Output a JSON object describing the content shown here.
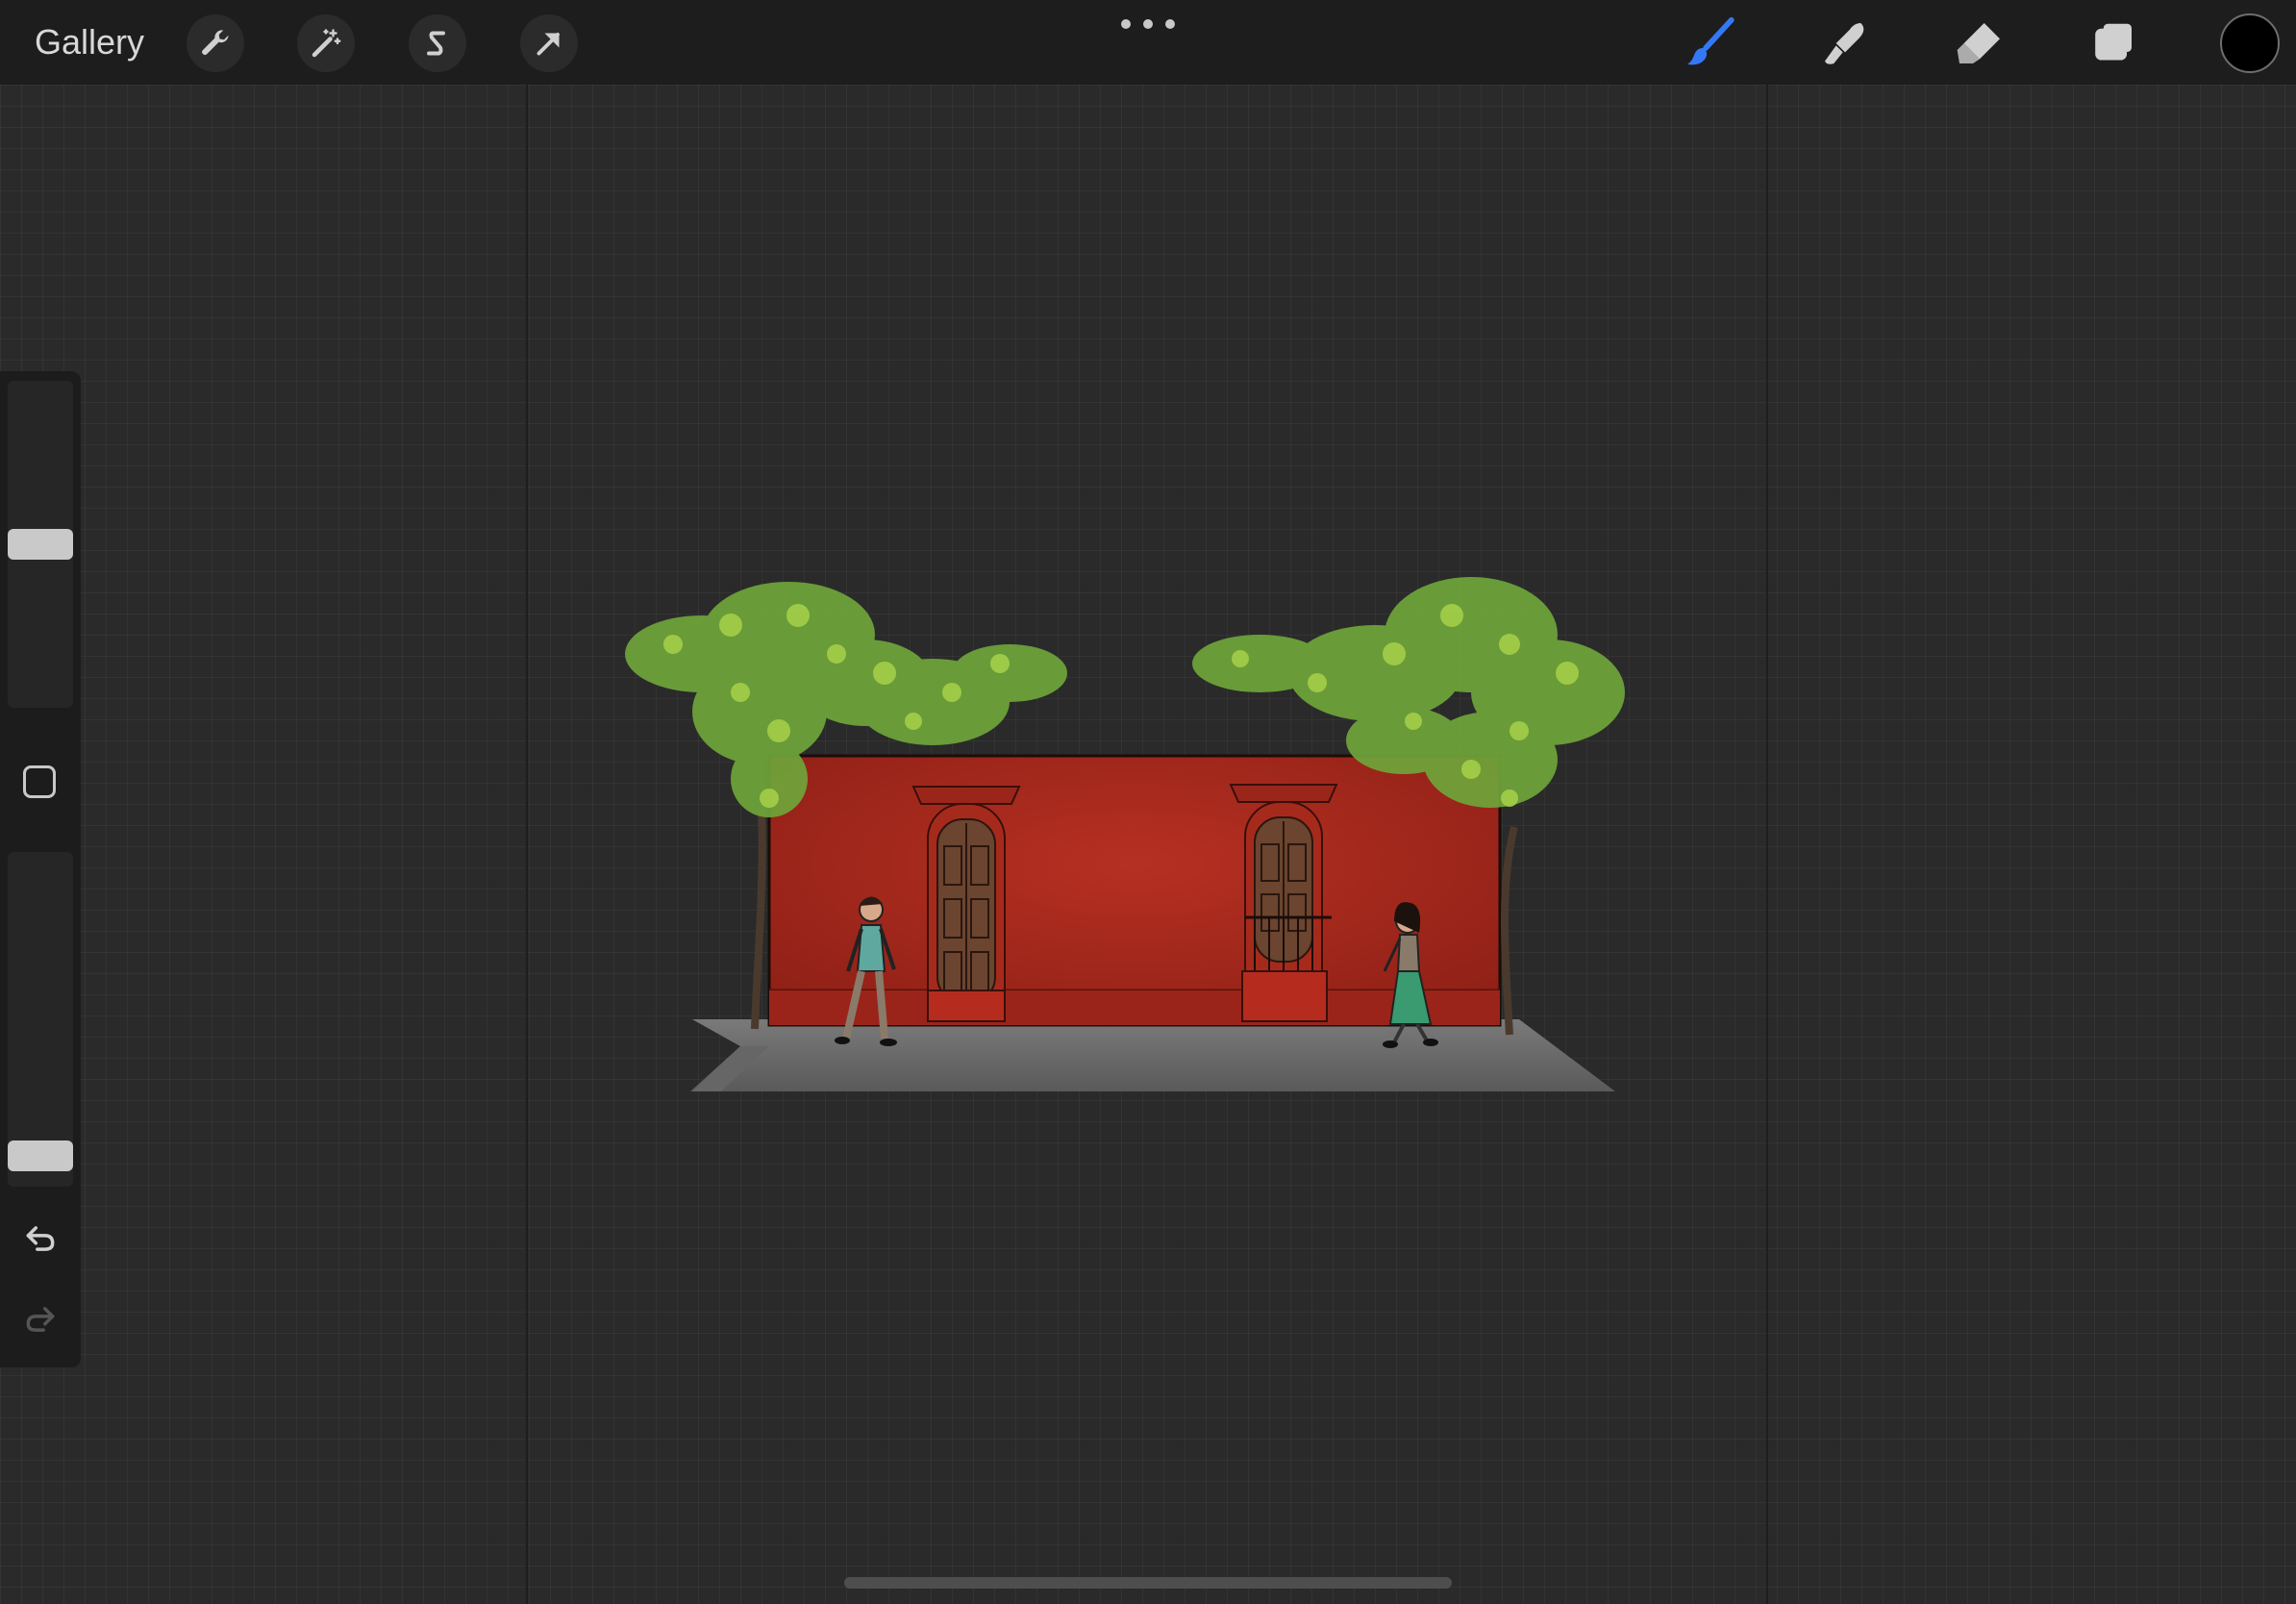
{
  "app": {
    "gallery_label": "Gallery"
  },
  "toolbar_left": [
    {
      "icon": "wrench-icon",
      "name": "actions"
    },
    {
      "icon": "magic-wand-icon",
      "name": "adjustments"
    },
    {
      "icon": "selection-s-icon",
      "name": "selection"
    },
    {
      "icon": "transform-arrow-icon",
      "name": "transform"
    }
  ],
  "toolbar_right": [
    {
      "icon": "brush-icon",
      "name": "paint",
      "active": true
    },
    {
      "icon": "smudge-icon",
      "name": "smudge",
      "active": false
    },
    {
      "icon": "eraser-icon",
      "name": "erase",
      "active": false
    },
    {
      "icon": "layers-icon",
      "name": "layers",
      "active": false
    }
  ],
  "color": {
    "current": "#000000",
    "active_tool": "#3478f6"
  },
  "sidebar": {
    "brush_size": 0.5,
    "opacity": 0.05
  },
  "artwork": {
    "wall_color": "#a8281a",
    "foliage_color": "#7fb53b",
    "sidewalk_color": "#6b6b6b"
  }
}
